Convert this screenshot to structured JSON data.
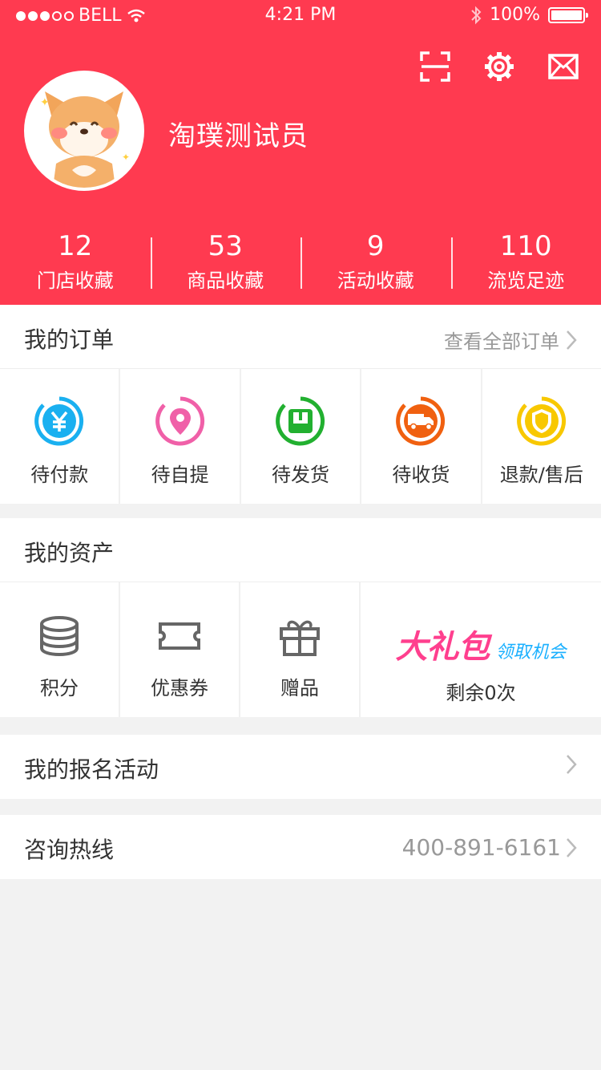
{
  "status_bar": {
    "carrier": "BELL",
    "time": "4:21 PM",
    "battery": "100%"
  },
  "header": {
    "username": "淘璞测试员",
    "icons": [
      "scan-icon",
      "gear-icon",
      "mail-icon"
    ],
    "stats": [
      {
        "value": "12",
        "label": "门店收藏"
      },
      {
        "value": "53",
        "label": "商品收藏"
      },
      {
        "value": "9",
        "label": "活动收藏"
      },
      {
        "value": "110",
        "label": "流览足迹"
      }
    ]
  },
  "orders": {
    "title": "我的订单",
    "view_all": "查看全部订单",
    "items": [
      {
        "label": "待付款",
        "icon": "yen-icon",
        "color": "#1ab0f0"
      },
      {
        "label": "待自提",
        "icon": "location-pin-icon",
        "color": "#f060a8"
      },
      {
        "label": "待发货",
        "icon": "package-icon",
        "color": "#22b030"
      },
      {
        "label": "待收货",
        "icon": "truck-icon",
        "color": "#f06010"
      },
      {
        "label": "退款/售后",
        "icon": "shield-icon",
        "color": "#f8c800"
      }
    ]
  },
  "assets": {
    "title": "我的资产",
    "items": [
      {
        "label": "积分",
        "icon": "coins-icon"
      },
      {
        "label": "优惠券",
        "icon": "coupon-icon"
      },
      {
        "label": "赠品",
        "icon": "gift-icon"
      }
    ],
    "promo": {
      "big_text": "大礼包",
      "small_text": "领取机会",
      "remaining": "剩余0次"
    }
  },
  "activities": {
    "title": "我的报名活动"
  },
  "hotline": {
    "title": "咨询热线",
    "phone": "400-891-6161"
  },
  "colors": {
    "brand": "#ff3a50",
    "page_bg": "#f2f2f2"
  }
}
